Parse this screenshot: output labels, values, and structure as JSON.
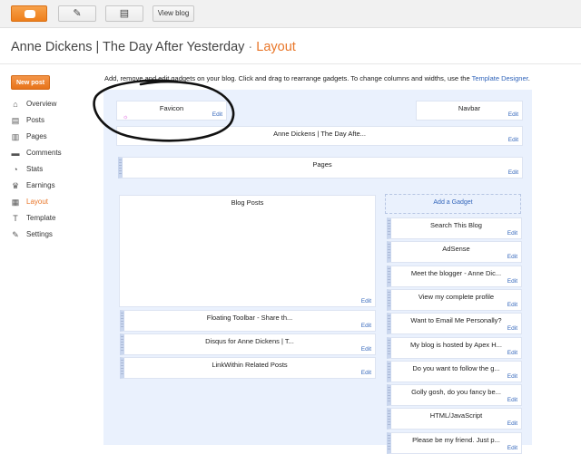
{
  "toolbar": {
    "view_blog_label": "View blog"
  },
  "header": {
    "blog_name": "Anne Dickens | The Day After Yesterday",
    "separator": "·",
    "section": "Layout"
  },
  "sidebar": {
    "new_post_label": "New post",
    "items": [
      {
        "label": "Overview",
        "icon": "home-icon",
        "glyph": "⌂"
      },
      {
        "label": "Posts",
        "icon": "posts-icon",
        "glyph": "▤"
      },
      {
        "label": "Pages",
        "icon": "pages-icon",
        "glyph": "▥"
      },
      {
        "label": "Comments",
        "icon": "comments-icon",
        "glyph": "▬"
      },
      {
        "label": "Stats",
        "icon": "stats-icon",
        "glyph": "◔"
      },
      {
        "label": "Earnings",
        "icon": "trophy-icon",
        "glyph": "♛"
      },
      {
        "label": "Layout",
        "icon": "layout-icon",
        "glyph": "▦"
      },
      {
        "label": "Template",
        "icon": "template-icon",
        "glyph": "T"
      },
      {
        "label": "Settings",
        "icon": "wrench-icon",
        "glyph": "✎"
      }
    ],
    "active": "Layout"
  },
  "intro": {
    "text": "Add, remove and edit gadgets on your blog. Click and drag to rearrange gadgets. To change columns and widths, use the ",
    "link": "Template Designer",
    "end": "."
  },
  "layout": {
    "edit_label": "Edit",
    "favicon": "Favicon",
    "navbar": "Navbar",
    "header_gadget": "Anne Dickens | The Day Afte...",
    "pages": "Pages",
    "blog_posts": "Blog Posts",
    "add_gadget": "Add a Gadget",
    "main_gadgets": [
      "Floating Toolbar - Share th...",
      "Disqus for Anne Dickens | T...",
      "LinkWithin Related Posts"
    ],
    "sidebar_gadgets": [
      "Search This Blog",
      "AdSense",
      "Meet the blogger - Anne Dic...",
      "View my complete profile",
      "Want to Email Me Personally?",
      "My blog is hosted by Apex H...",
      "Do you want to follow the g...",
      "Golly gosh, do you fancy be...",
      "HTML/JavaScript",
      "Please be my friend. Just p..."
    ]
  },
  "colors": {
    "accent": "#e9772a",
    "link": "#3366bb",
    "canvas": "#eaf1fd"
  }
}
